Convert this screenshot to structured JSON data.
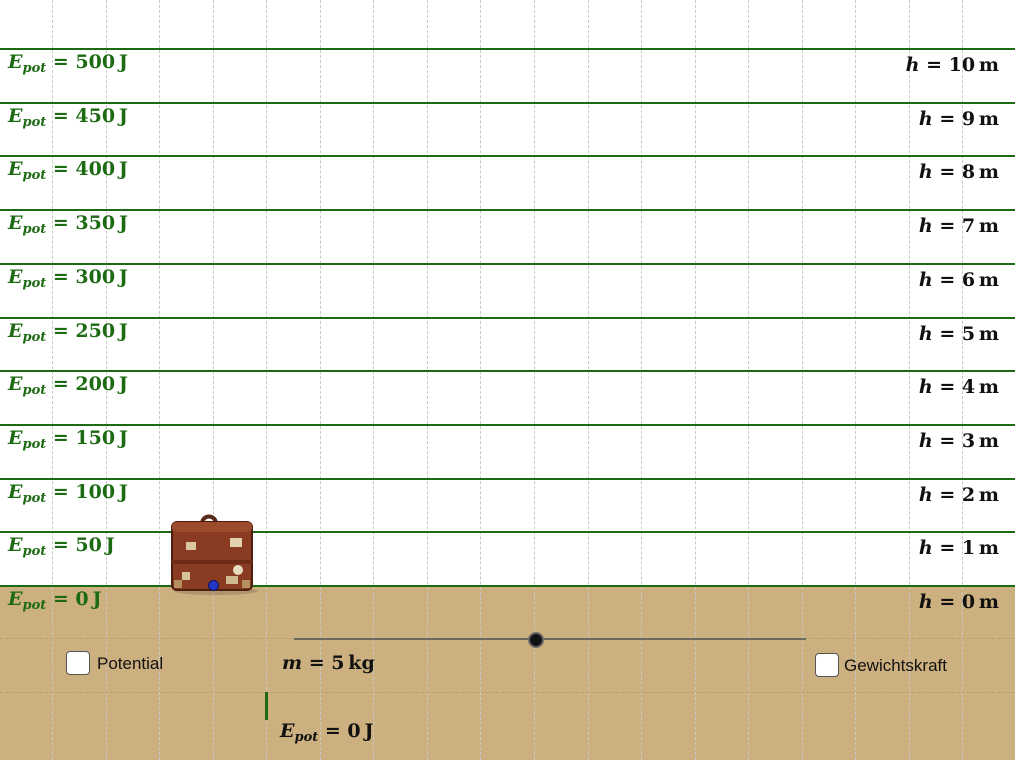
{
  "levels": [
    {
      "energy": "500",
      "height": "10"
    },
    {
      "energy": "450",
      "height": "9"
    },
    {
      "energy": "400",
      "height": "8"
    },
    {
      "energy": "350",
      "height": "7"
    },
    {
      "energy": "300",
      "height": "6"
    },
    {
      "energy": "250",
      "height": "5"
    },
    {
      "energy": "200",
      "height": "4"
    },
    {
      "energy": "150",
      "height": "3"
    },
    {
      "energy": "100",
      "height": "2"
    },
    {
      "energy": "50",
      "height": "1"
    },
    {
      "energy": "0",
      "height": "0"
    }
  ],
  "symbols": {
    "E": "E",
    "pot": "pot",
    "h": "h",
    "m": "m",
    "equals": " = ",
    "joule": "J",
    "meter": "m",
    "kg": "kg"
  },
  "checkboxes": {
    "potential_label": "Potential",
    "potential_checked": false,
    "weight_label": "Gewichtskraft",
    "weight_checked": false
  },
  "mass": {
    "value": "5",
    "unit": "kg"
  },
  "readout": {
    "energy": "0"
  },
  "colors": {
    "energy_line": "#1c6b12",
    "ground": "#cdb07f",
    "point": "#2438c8"
  },
  "icons": {
    "suitcase": "suitcase-icon"
  }
}
